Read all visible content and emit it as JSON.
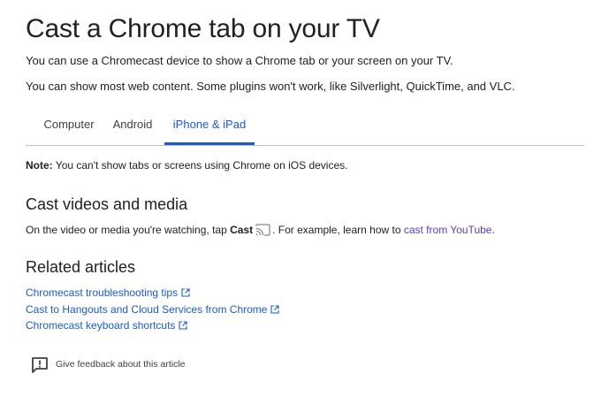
{
  "article": {
    "title": "Cast a Chrome tab on your TV",
    "intro_1": "You can use a Chromecast device to show a Chrome tab or your screen on your TV.",
    "intro_2": "You can show most web content. Some plugins won't work, like Silverlight, QuickTime, and VLC."
  },
  "tabs": [
    {
      "label": "Computer",
      "selected": false
    },
    {
      "label": "Android",
      "selected": false
    },
    {
      "label": "iPhone & iPad",
      "selected": true
    }
  ],
  "note": {
    "label": "Note:",
    "text": " You can't show tabs or screens using Chrome on iOS devices."
  },
  "cast_section": {
    "heading": "Cast videos and media",
    "text_before": "On the video or media you're watching, tap ",
    "bold_word": "Cast",
    "text_after": ". For example, learn how to ",
    "link_text": "cast from YouTube",
    "text_end": ".",
    "icon": "cast-icon"
  },
  "related": {
    "heading": "Related articles",
    "items": [
      {
        "label": "Chromecast troubleshooting tips",
        "icon": "external-link-icon"
      },
      {
        "label": "Cast to Hangouts and Cloud Services from Chrome",
        "icon": "external-link-icon"
      },
      {
        "label": "Chromecast keyboard shortcuts",
        "icon": "external-link-icon"
      }
    ]
  },
  "feedback": {
    "label": "Give feedback about this article",
    "icon": "feedback-icon"
  },
  "colors": {
    "text": "#202124",
    "link_blue": "#1a5ac9",
    "visited_link_purple": "#5c39c0",
    "tab_active": "#1a5ac9",
    "divider": "#bdc1c6"
  }
}
